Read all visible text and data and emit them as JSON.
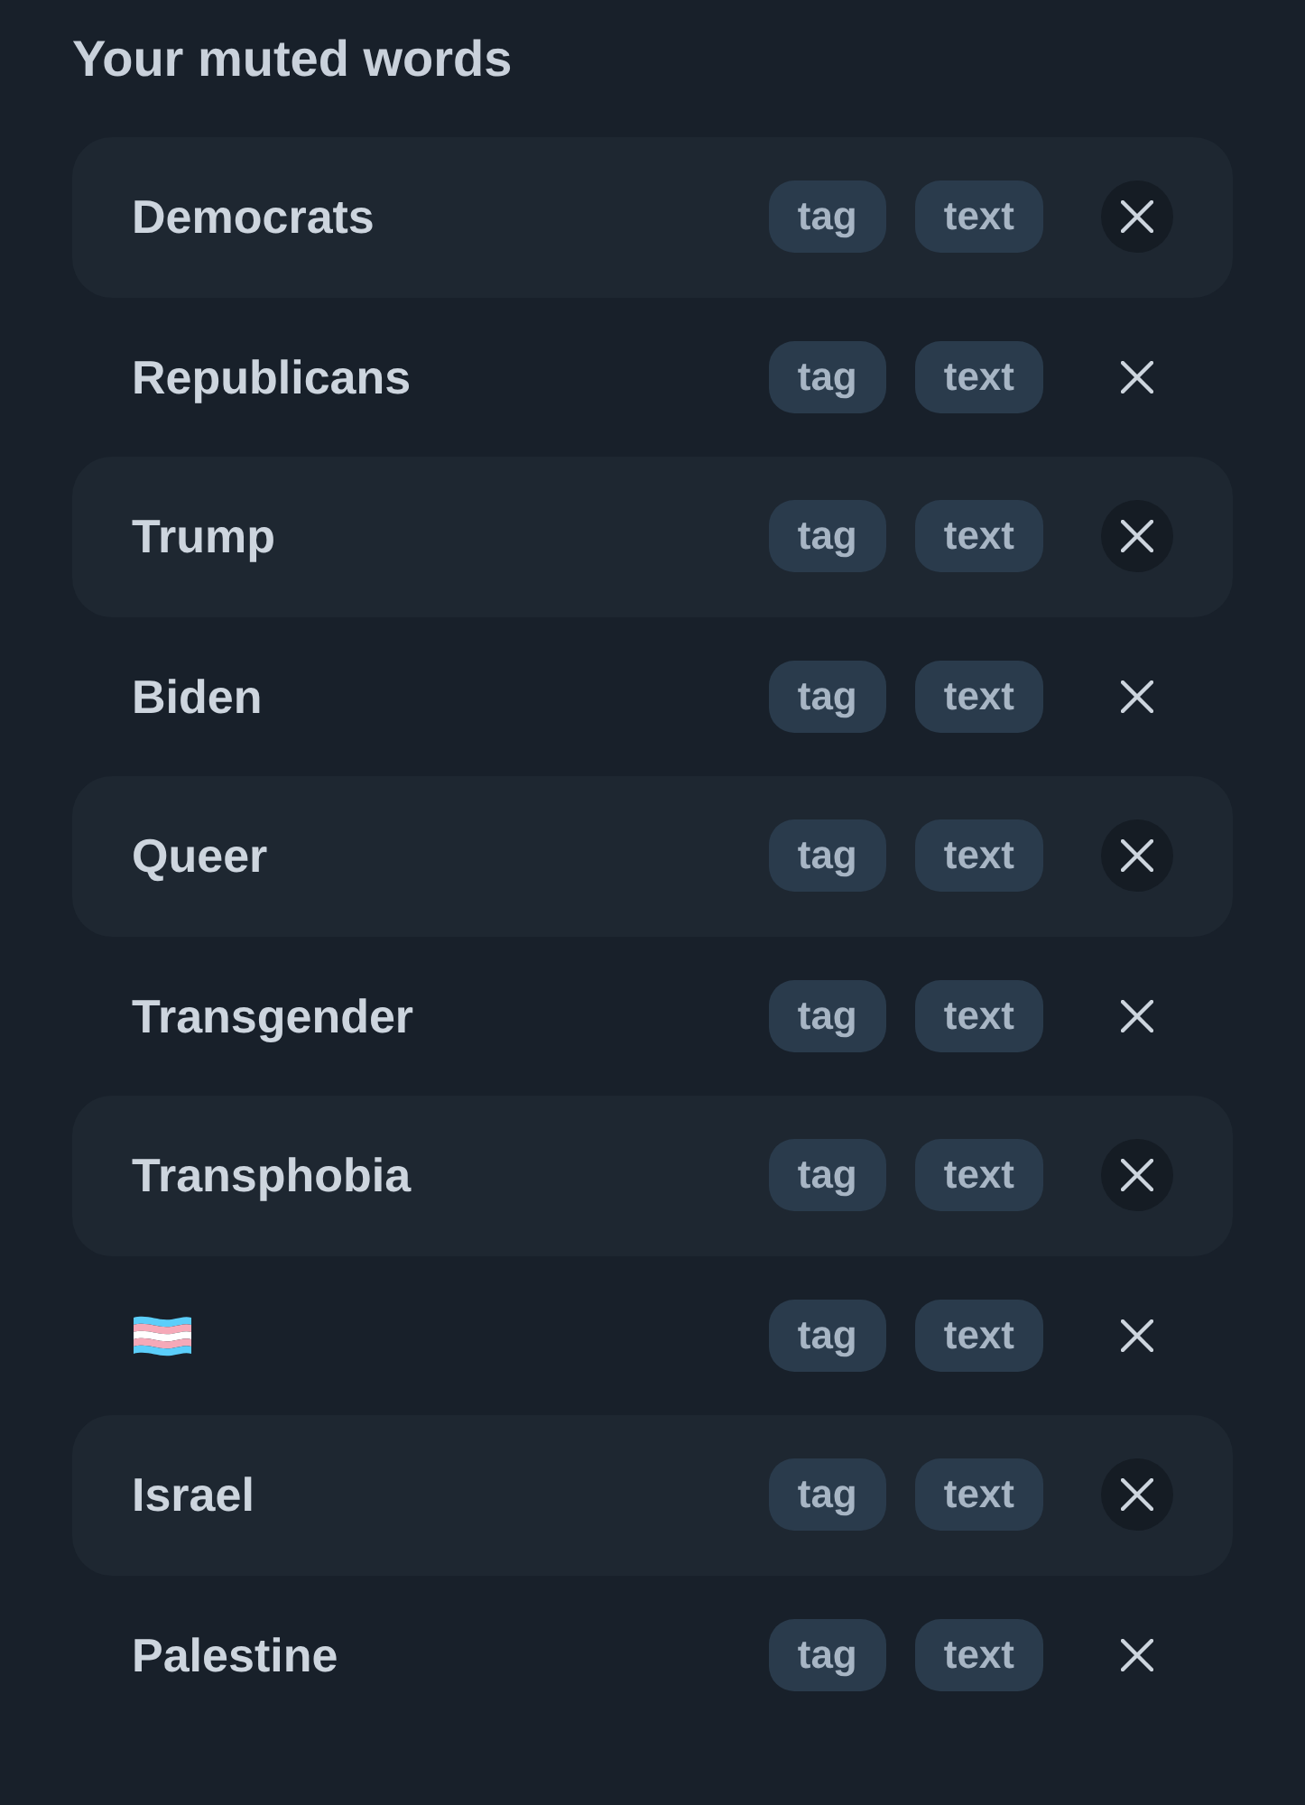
{
  "title": "Your muted words",
  "muted_words": [
    {
      "kind": "word",
      "word": "Democrats",
      "targets": [
        "tag",
        "text"
      ]
    },
    {
      "kind": "word",
      "word": "Republicans",
      "targets": [
        "tag",
        "text"
      ]
    },
    {
      "kind": "word",
      "word": "Trump",
      "targets": [
        "tag",
        "text"
      ]
    },
    {
      "kind": "word",
      "word": "Biden",
      "targets": [
        "tag",
        "text"
      ]
    },
    {
      "kind": "word",
      "word": "Queer",
      "targets": [
        "tag",
        "text"
      ]
    },
    {
      "kind": "word",
      "word": "Transgender",
      "targets": [
        "tag",
        "text"
      ]
    },
    {
      "kind": "word",
      "word": "Transphobia",
      "targets": [
        "tag",
        "text"
      ]
    },
    {
      "kind": "flag",
      "targets": [
        "tag",
        "text"
      ]
    },
    {
      "kind": "word",
      "word": "Israel",
      "targets": [
        "tag",
        "text"
      ]
    },
    {
      "kind": "word",
      "word": "Palestine",
      "targets": [
        "tag",
        "text"
      ]
    }
  ]
}
